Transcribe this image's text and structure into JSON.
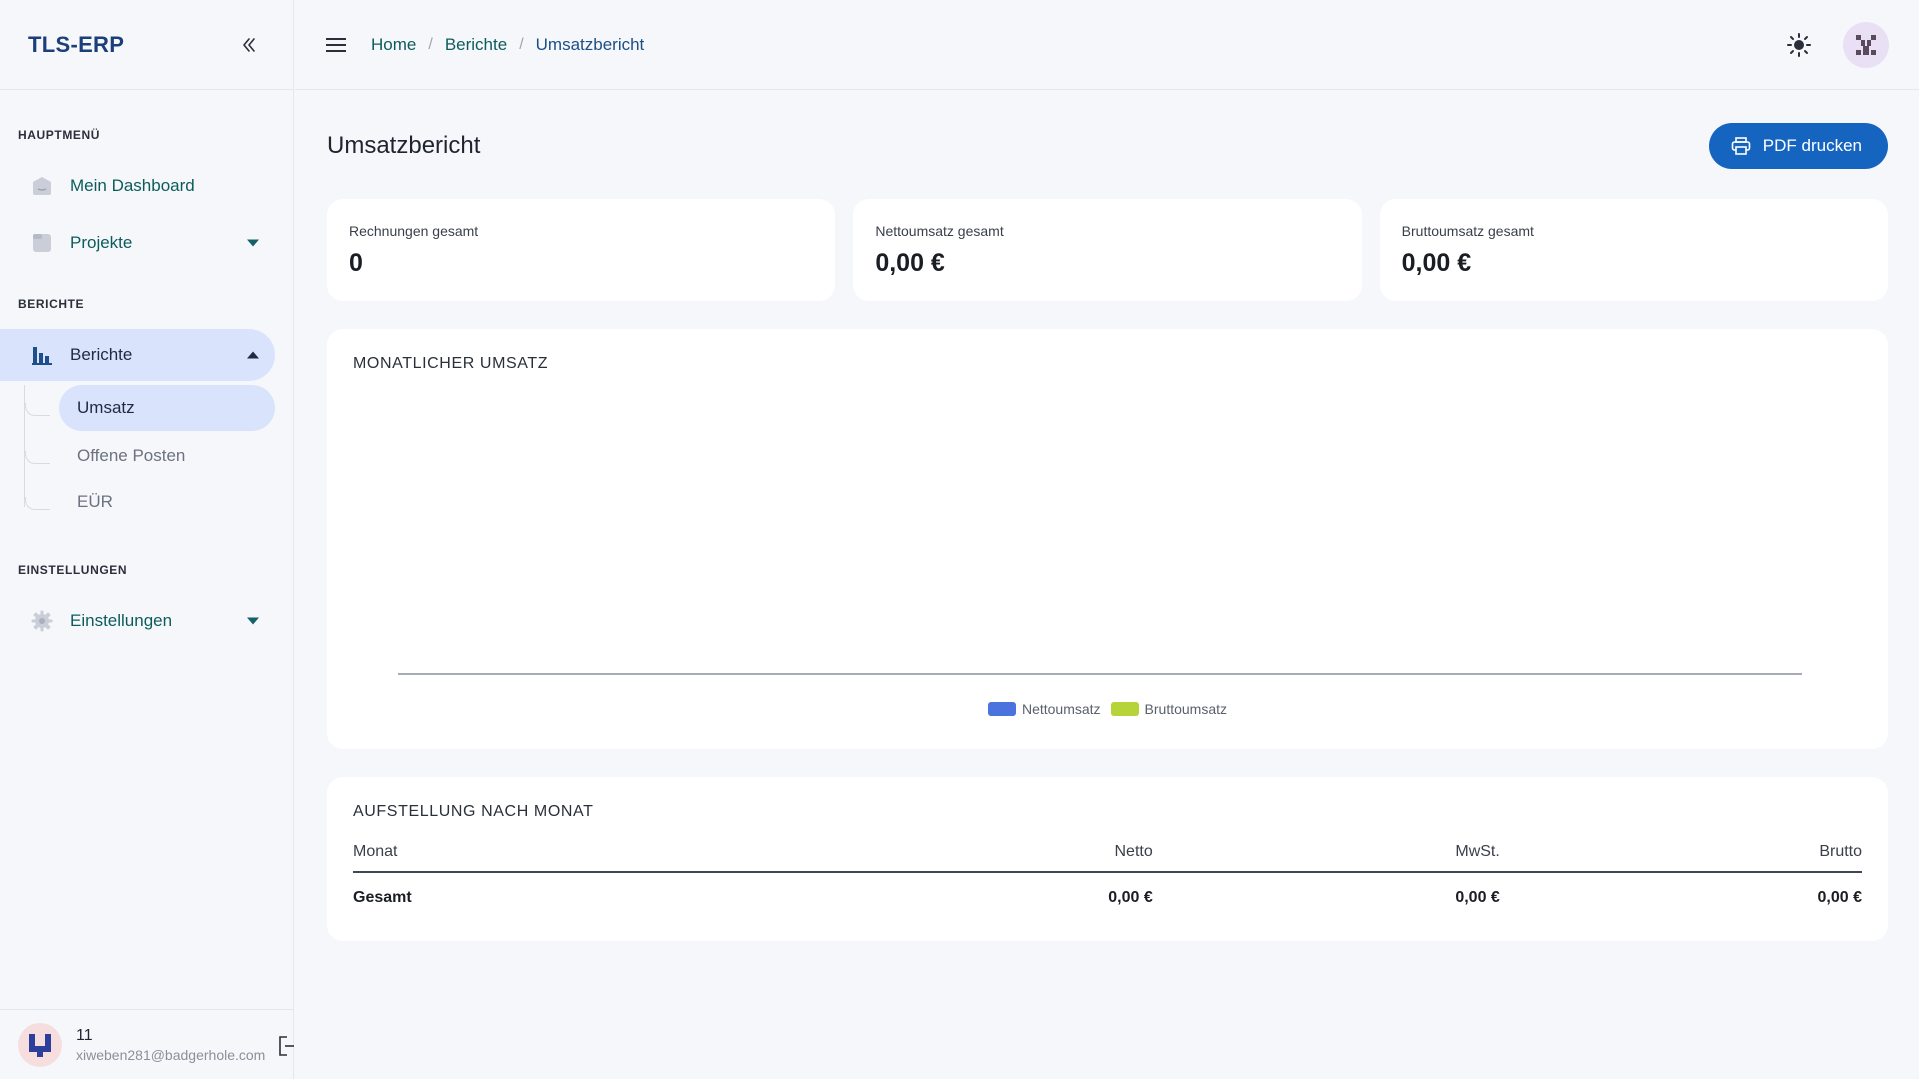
{
  "app": {
    "brand": "TLS-ERP"
  },
  "sidebar": {
    "sections": [
      {
        "title": "HAUPTMENÜ",
        "items": [
          {
            "label": "Mein Dashboard",
            "icon": "dashboard-icon"
          },
          {
            "label": "Projekte",
            "icon": "folder-icon",
            "expandable": true
          }
        ]
      },
      {
        "title": "BERICHTE",
        "items": [
          {
            "label": "Berichte",
            "icon": "bar-chart-icon",
            "expanded": true,
            "children": [
              {
                "label": "Umsatz",
                "active": true
              },
              {
                "label": "Offene Posten"
              },
              {
                "label": "EÜR"
              }
            ]
          }
        ]
      },
      {
        "title": "EINSTELLUNGEN",
        "items": [
          {
            "label": "Einstellungen",
            "icon": "gear-icon",
            "expandable": true
          }
        ]
      }
    ],
    "user": {
      "name": "11",
      "email": "xiweben281@badgerhole.com"
    }
  },
  "breadcrumb": [
    "Home",
    "Berichte",
    "Umsatzbericht"
  ],
  "page": {
    "title": "Umsatzbericht",
    "pdf_button": "PDF drucken"
  },
  "stats": [
    {
      "label": "Rechnungen gesamt",
      "value": "0"
    },
    {
      "label": "Nettoumsatz gesamt",
      "value": "0,00 €"
    },
    {
      "label": "Bruttoumsatz gesamt",
      "value": "0,00 €"
    }
  ],
  "chart_card": {
    "title": "MONATLICHER UMSATZ"
  },
  "chart_data": {
    "type": "bar",
    "title": "MONATLICHER UMSATZ",
    "categories": [],
    "series": [
      {
        "name": "Nettoumsatz",
        "values": [],
        "color": "#4a73dd"
      },
      {
        "name": "Bruttoumsatz",
        "values": [],
        "color": "#b6d43a"
      }
    ],
    "legend": "bottom",
    "grid": false
  },
  "table_card": {
    "title": "AUFSTELLUNG NACH MONAT",
    "columns": [
      "Monat",
      "Netto",
      "MwSt.",
      "Brutto"
    ],
    "total_row": [
      "Gesamt",
      "0,00 €",
      "0,00 €",
      "0,00 €"
    ]
  },
  "colors": {
    "accent": "#1565c0",
    "brand": "#1b3f7a",
    "nav_text": "#0d5c5c",
    "active_bg": "#d9e3fb"
  }
}
